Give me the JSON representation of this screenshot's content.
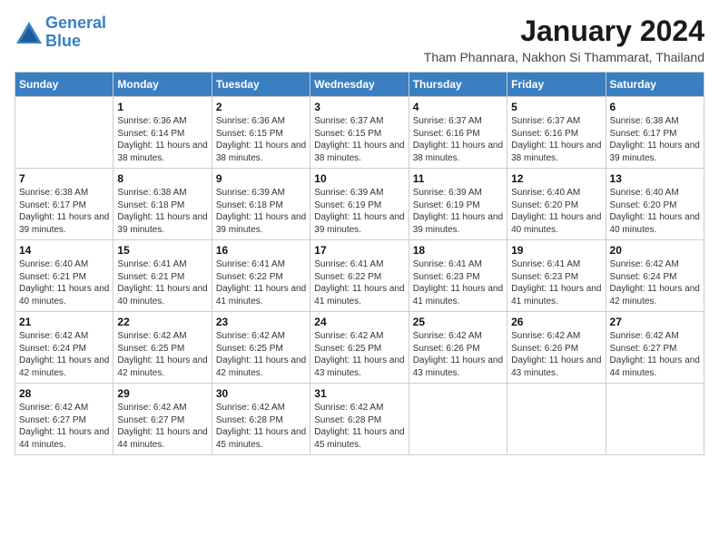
{
  "header": {
    "logo_line1": "General",
    "logo_line2": "Blue",
    "month_title": "January 2024",
    "subtitle": "Tham Phannara, Nakhon Si Thammarat, Thailand"
  },
  "weekdays": [
    "Sunday",
    "Monday",
    "Tuesday",
    "Wednesday",
    "Thursday",
    "Friday",
    "Saturday"
  ],
  "weeks": [
    [
      {
        "day": "",
        "sunrise": "",
        "sunset": "",
        "daylight": ""
      },
      {
        "day": "1",
        "sunrise": "Sunrise: 6:36 AM",
        "sunset": "Sunset: 6:14 PM",
        "daylight": "Daylight: 11 hours and 38 minutes."
      },
      {
        "day": "2",
        "sunrise": "Sunrise: 6:36 AM",
        "sunset": "Sunset: 6:15 PM",
        "daylight": "Daylight: 11 hours and 38 minutes."
      },
      {
        "day": "3",
        "sunrise": "Sunrise: 6:37 AM",
        "sunset": "Sunset: 6:15 PM",
        "daylight": "Daylight: 11 hours and 38 minutes."
      },
      {
        "day": "4",
        "sunrise": "Sunrise: 6:37 AM",
        "sunset": "Sunset: 6:16 PM",
        "daylight": "Daylight: 11 hours and 38 minutes."
      },
      {
        "day": "5",
        "sunrise": "Sunrise: 6:37 AM",
        "sunset": "Sunset: 6:16 PM",
        "daylight": "Daylight: 11 hours and 38 minutes."
      },
      {
        "day": "6",
        "sunrise": "Sunrise: 6:38 AM",
        "sunset": "Sunset: 6:17 PM",
        "daylight": "Daylight: 11 hours and 39 minutes."
      }
    ],
    [
      {
        "day": "7",
        "sunrise": "Sunrise: 6:38 AM",
        "sunset": "Sunset: 6:17 PM",
        "daylight": "Daylight: 11 hours and 39 minutes."
      },
      {
        "day": "8",
        "sunrise": "Sunrise: 6:38 AM",
        "sunset": "Sunset: 6:18 PM",
        "daylight": "Daylight: 11 hours and 39 minutes."
      },
      {
        "day": "9",
        "sunrise": "Sunrise: 6:39 AM",
        "sunset": "Sunset: 6:18 PM",
        "daylight": "Daylight: 11 hours and 39 minutes."
      },
      {
        "day": "10",
        "sunrise": "Sunrise: 6:39 AM",
        "sunset": "Sunset: 6:19 PM",
        "daylight": "Daylight: 11 hours and 39 minutes."
      },
      {
        "day": "11",
        "sunrise": "Sunrise: 6:39 AM",
        "sunset": "Sunset: 6:19 PM",
        "daylight": "Daylight: 11 hours and 39 minutes."
      },
      {
        "day": "12",
        "sunrise": "Sunrise: 6:40 AM",
        "sunset": "Sunset: 6:20 PM",
        "daylight": "Daylight: 11 hours and 40 minutes."
      },
      {
        "day": "13",
        "sunrise": "Sunrise: 6:40 AM",
        "sunset": "Sunset: 6:20 PM",
        "daylight": "Daylight: 11 hours and 40 minutes."
      }
    ],
    [
      {
        "day": "14",
        "sunrise": "Sunrise: 6:40 AM",
        "sunset": "Sunset: 6:21 PM",
        "daylight": "Daylight: 11 hours and 40 minutes."
      },
      {
        "day": "15",
        "sunrise": "Sunrise: 6:41 AM",
        "sunset": "Sunset: 6:21 PM",
        "daylight": "Daylight: 11 hours and 40 minutes."
      },
      {
        "day": "16",
        "sunrise": "Sunrise: 6:41 AM",
        "sunset": "Sunset: 6:22 PM",
        "daylight": "Daylight: 11 hours and 41 minutes."
      },
      {
        "day": "17",
        "sunrise": "Sunrise: 6:41 AM",
        "sunset": "Sunset: 6:22 PM",
        "daylight": "Daylight: 11 hours and 41 minutes."
      },
      {
        "day": "18",
        "sunrise": "Sunrise: 6:41 AM",
        "sunset": "Sunset: 6:23 PM",
        "daylight": "Daylight: 11 hours and 41 minutes."
      },
      {
        "day": "19",
        "sunrise": "Sunrise: 6:41 AM",
        "sunset": "Sunset: 6:23 PM",
        "daylight": "Daylight: 11 hours and 41 minutes."
      },
      {
        "day": "20",
        "sunrise": "Sunrise: 6:42 AM",
        "sunset": "Sunset: 6:24 PM",
        "daylight": "Daylight: 11 hours and 42 minutes."
      }
    ],
    [
      {
        "day": "21",
        "sunrise": "Sunrise: 6:42 AM",
        "sunset": "Sunset: 6:24 PM",
        "daylight": "Daylight: 11 hours and 42 minutes."
      },
      {
        "day": "22",
        "sunrise": "Sunrise: 6:42 AM",
        "sunset": "Sunset: 6:25 PM",
        "daylight": "Daylight: 11 hours and 42 minutes."
      },
      {
        "day": "23",
        "sunrise": "Sunrise: 6:42 AM",
        "sunset": "Sunset: 6:25 PM",
        "daylight": "Daylight: 11 hours and 42 minutes."
      },
      {
        "day": "24",
        "sunrise": "Sunrise: 6:42 AM",
        "sunset": "Sunset: 6:25 PM",
        "daylight": "Daylight: 11 hours and 43 minutes."
      },
      {
        "day": "25",
        "sunrise": "Sunrise: 6:42 AM",
        "sunset": "Sunset: 6:26 PM",
        "daylight": "Daylight: 11 hours and 43 minutes."
      },
      {
        "day": "26",
        "sunrise": "Sunrise: 6:42 AM",
        "sunset": "Sunset: 6:26 PM",
        "daylight": "Daylight: 11 hours and 43 minutes."
      },
      {
        "day": "27",
        "sunrise": "Sunrise: 6:42 AM",
        "sunset": "Sunset: 6:27 PM",
        "daylight": "Daylight: 11 hours and 44 minutes."
      }
    ],
    [
      {
        "day": "28",
        "sunrise": "Sunrise: 6:42 AM",
        "sunset": "Sunset: 6:27 PM",
        "daylight": "Daylight: 11 hours and 44 minutes."
      },
      {
        "day": "29",
        "sunrise": "Sunrise: 6:42 AM",
        "sunset": "Sunset: 6:27 PM",
        "daylight": "Daylight: 11 hours and 44 minutes."
      },
      {
        "day": "30",
        "sunrise": "Sunrise: 6:42 AM",
        "sunset": "Sunset: 6:28 PM",
        "daylight": "Daylight: 11 hours and 45 minutes."
      },
      {
        "day": "31",
        "sunrise": "Sunrise: 6:42 AM",
        "sunset": "Sunset: 6:28 PM",
        "daylight": "Daylight: 11 hours and 45 minutes."
      },
      {
        "day": "",
        "sunrise": "",
        "sunset": "",
        "daylight": ""
      },
      {
        "day": "",
        "sunrise": "",
        "sunset": "",
        "daylight": ""
      },
      {
        "day": "",
        "sunrise": "",
        "sunset": "",
        "daylight": ""
      }
    ]
  ]
}
